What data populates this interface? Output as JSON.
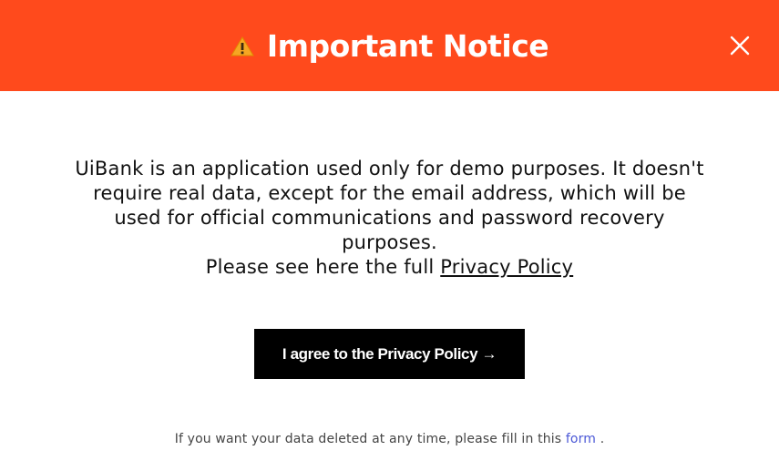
{
  "dialog": {
    "title": "Important Notice",
    "warning_icon": "warning-icon",
    "close_icon": "close-icon",
    "header_color": "#ff4a1c"
  },
  "body": {
    "line1": "UiBank is an application used only for demo purposes. It doesn't",
    "line2": "require real data, except for the email address, which will be",
    "line3": "used for official communications and password recovery",
    "line4": "purposes.",
    "line5_prefix": "Please see here the full ",
    "privacy_link": "Privacy Policy"
  },
  "agree_button": {
    "label": "I agree to the Privacy Policy →"
  },
  "footer": {
    "text_prefix": "If you want your data deleted at any time, please fill in this ",
    "form_link": "form",
    "text_suffix": " ."
  },
  "colors": {
    "accent": "#ff4a1c",
    "button_bg": "#000000",
    "link_blue": "#4a57d6"
  }
}
